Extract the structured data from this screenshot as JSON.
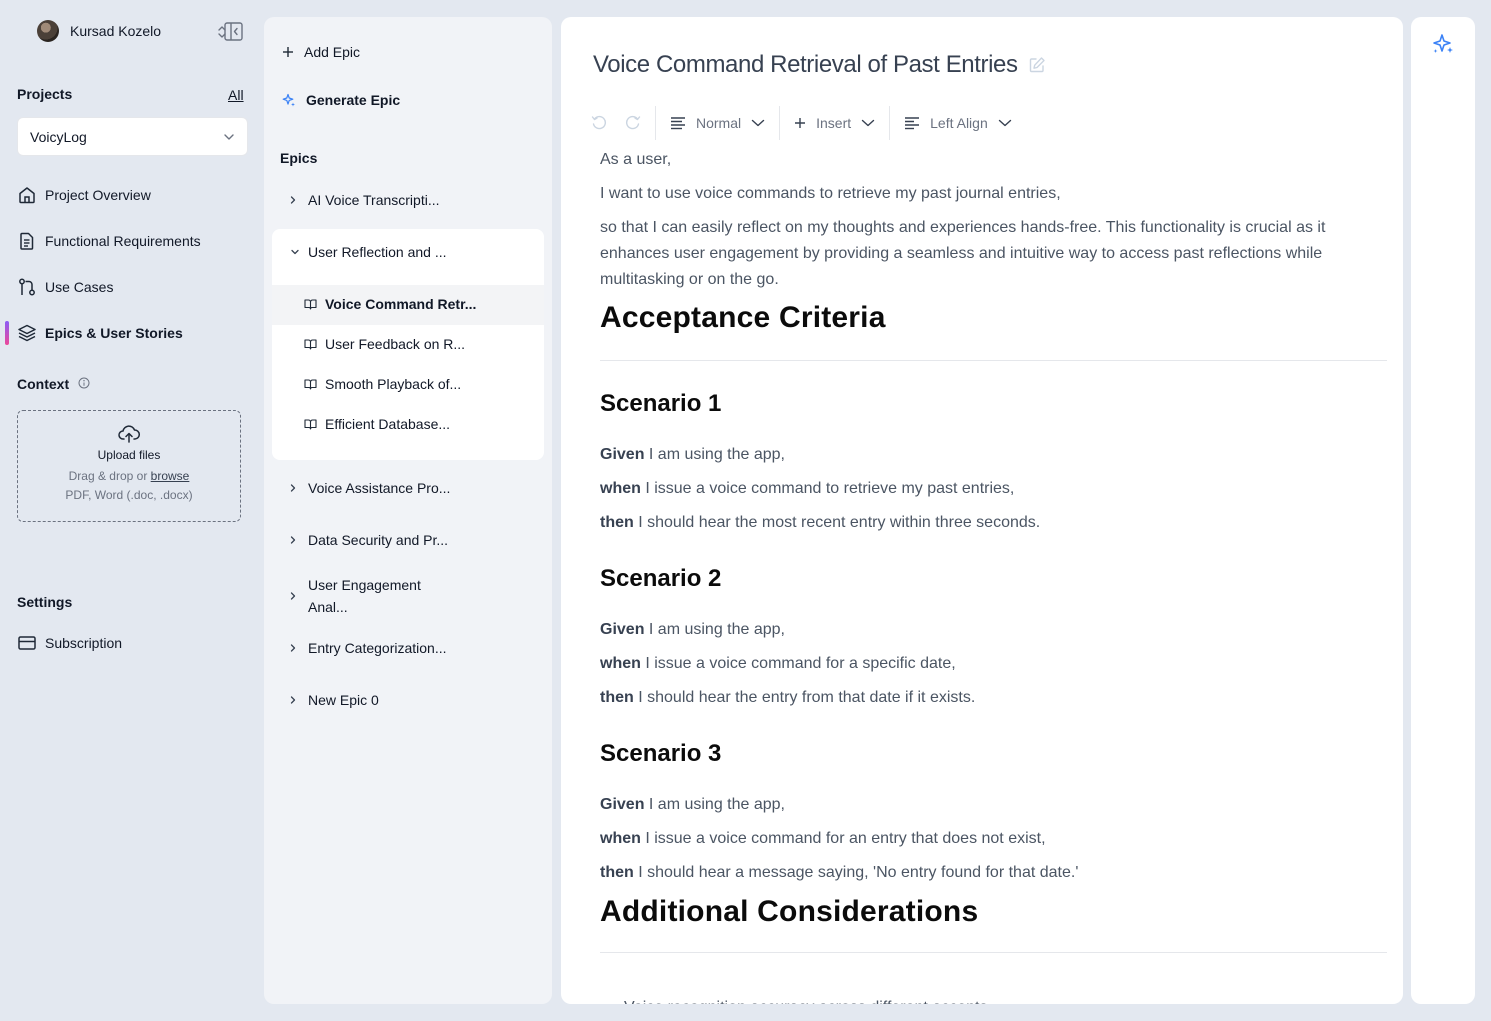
{
  "user": {
    "name": "Kursad Kozelo"
  },
  "projects": {
    "title": "Projects",
    "all_label": "All",
    "selected": "VoicyLog"
  },
  "nav": [
    {
      "label": "Project Overview",
      "icon": "home-icon"
    },
    {
      "label": "Functional Requirements",
      "icon": "document-icon"
    },
    {
      "label": "Use Cases",
      "icon": "git-branch-icon"
    },
    {
      "label": "Epics & User Stories",
      "icon": "layers-icon",
      "active": true
    }
  ],
  "context": {
    "title": "Context",
    "upload_title": "Upload files",
    "upload_hint": "Drag & drop or",
    "upload_link": "browse",
    "upload_formats": "PDF, Word (.doc, .docx)"
  },
  "settings": {
    "title": "Settings",
    "subscription": "Subscription"
  },
  "epics_panel": {
    "add_epic": "Add Epic",
    "generate_epic": "Generate Epic",
    "epics_label": "Epics",
    "epics": [
      "AI Voice Transcripti...",
      "User Reflection and ...",
      "Voice Assistance Pro...",
      "Data Security and Pr...",
      "User Engagement Anal...",
      "Entry Categorization...",
      "New Epic 0"
    ],
    "stories": [
      "Voice Command Retr...",
      "User Feedback on R...",
      "Smooth Playback of...",
      "Efficient Database..."
    ]
  },
  "editor": {
    "title": "Voice Command Retrieval of Past Entries",
    "toolbar": {
      "style": "Normal",
      "insert": "Insert",
      "align": "Left Align"
    },
    "intro": [
      "As a user,",
      "I want to use voice commands to retrieve my past journal entries,",
      "so that I can easily reflect on my thoughts and experiences hands-free. This functionality is crucial as it enhances user engagement by providing a seamless and intuitive way to access past reflections while multitasking or on the go."
    ],
    "acceptance_heading": "Acceptance Criteria",
    "scenarios": [
      {
        "title": "Scenario 1",
        "given_kw": "Given",
        "given": " I am using the app,",
        "when_kw": "when",
        "when": " I issue a voice command to retrieve my past entries,",
        "then_kw": "then",
        "then": " I should hear the most recent entry within three seconds."
      },
      {
        "title": "Scenario 2",
        "given_kw": "Given",
        "given": " I am using the app,",
        "when_kw": "when",
        "when": " I issue a voice command for a specific date,",
        "then_kw": "then",
        "then": " I should hear the entry from that date if it exists."
      },
      {
        "title": "Scenario 3",
        "given_kw": "Given",
        "given": " I am using the app,",
        "when_kw": "when",
        "when": " I issue a voice command for an entry that does not exist,",
        "then_kw": "then",
        "then": " I should hear a message saying, 'No entry found for that date.'"
      }
    ],
    "additional_heading": "Additional Considerations",
    "considerations": [
      "Voice recognition accuracy across different accents."
    ]
  },
  "colors": {
    "accent": "#3b82f6",
    "active_gradient_start": "#8b5cf6",
    "active_gradient_end": "#ec4899"
  }
}
